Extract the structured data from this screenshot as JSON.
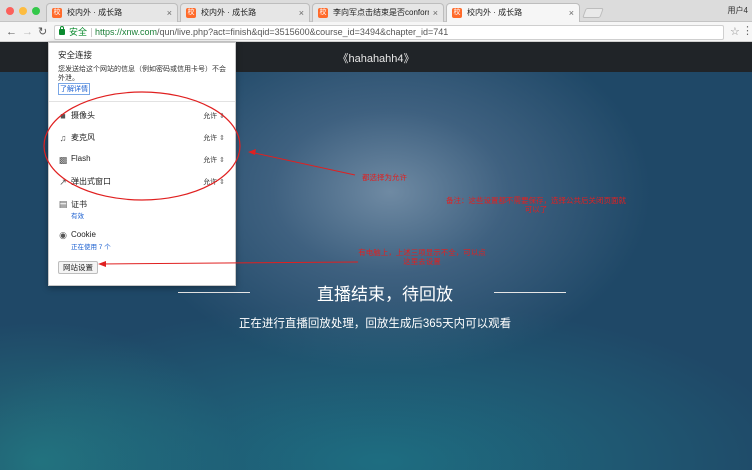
{
  "browser": {
    "tabs": [
      {
        "title": "校内外 · 成长路",
        "active": false
      },
      {
        "title": "校内外 · 成长路",
        "active": false
      },
      {
        "title": "李向军点击结束是否conform · 校",
        "active": false
      },
      {
        "title": "校内外 · 成长路",
        "active": true
      }
    ],
    "tab_icon_glyph": "校",
    "tab_close_glyph": "×",
    "user_label": "用户4",
    "security_label": "安全",
    "url_host": "https://xnw.com",
    "url_path": "/qun/live.php?act=finish&qid=3515600&course_id=3494&chapter_id=741"
  },
  "site_popup": {
    "title": "安全连接",
    "description": "您发送给这个网站的信息（例如密码或信用卡号）不会外泄。",
    "learn_more": "了解详情",
    "permissions": [
      {
        "label": "摄像头",
        "value": "允许",
        "icon": "camera-icon"
      },
      {
        "label": "麦克风",
        "value": "允许",
        "icon": "microphone-icon"
      },
      {
        "label": "Flash",
        "value": "允许",
        "icon": "puzzle-icon"
      },
      {
        "label": "弹出式窗口",
        "value": "允许",
        "icon": "popup-icon"
      }
    ],
    "certificate": {
      "label": "证书",
      "status": "有效"
    },
    "cookie": {
      "label": "Cookie",
      "status": "正在使用 7 个"
    },
    "site_settings_button": "网站设置"
  },
  "page": {
    "room_title": "《hahahahh4》",
    "end_title": "直播结束，待回放",
    "end_subtitle": "正在进行直播回放处理，回放生成后365天内可以观看"
  },
  "annotations": {
    "allow_all": "都选择为允许",
    "note": "备注：这些设置都不需要保存，选择公共后关闭页面就可以了",
    "site_settings_hint": "有电脑上，上述三项显示不全，可以点这里去设置"
  },
  "colors": {
    "annotation": "#e02020",
    "secure_green": "#0a8a2e",
    "link_blue": "#1a5fd0",
    "favicon_orange": "#ff6a2a"
  }
}
